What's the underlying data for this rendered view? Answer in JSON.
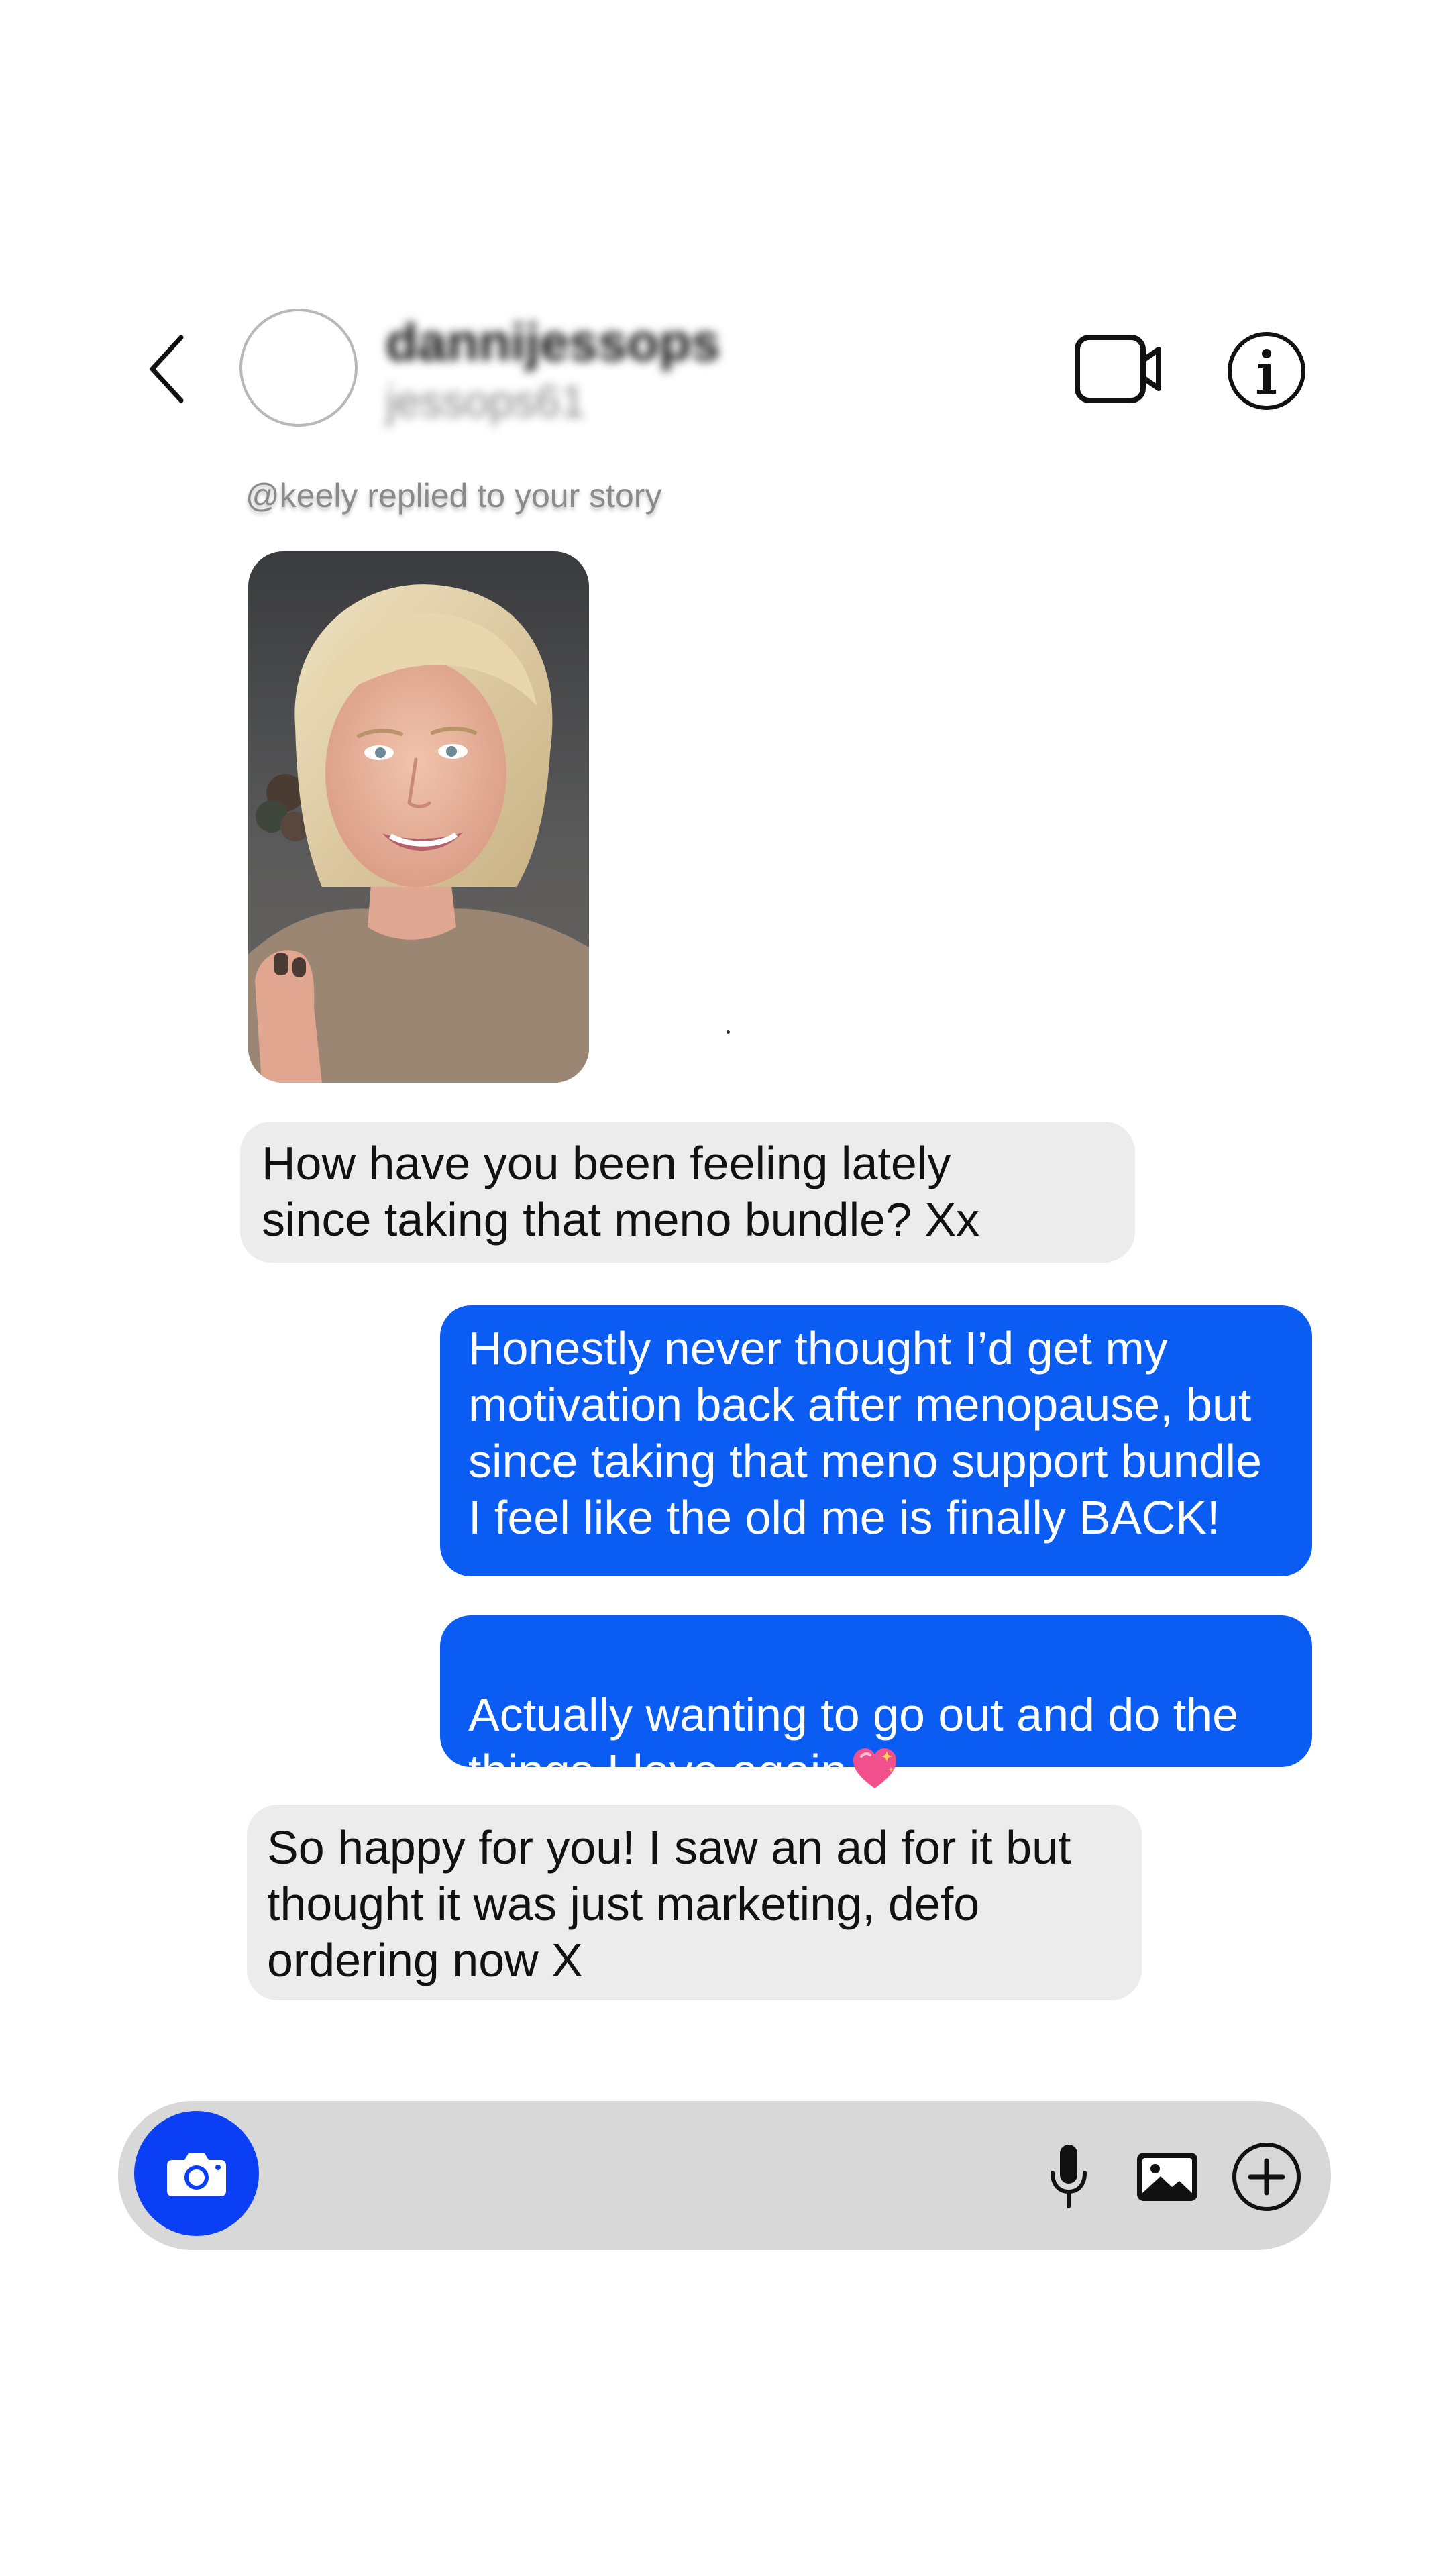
{
  "header": {
    "back_icon": "chevron-left-icon",
    "profile_name": "dannijessops",
    "profile_handle": "jessops61",
    "video_icon": "video-camera-icon",
    "info_icon": "info-icon"
  },
  "story": {
    "reply_note": "@keely replied to your story"
  },
  "messages": [
    {
      "direction": "incoming",
      "text": " How have you been feeling lately\nsince taking that meno bundle? Xx"
    },
    {
      "direction": "outgoing",
      "text": "Honestly never thought I’d get my\nmotivation back after menopause, but\nsince taking that meno support bundle\nI feel like the old me is finally BACK!"
    },
    {
      "direction": "outgoing",
      "text": "Actually wanting to go out and do the\nthings I love again",
      "emoji": "sparkling-heart-icon"
    },
    {
      "direction": "incoming",
      "text": "So happy for you! I saw an ad for it but\nthought it was just marketing, defo\nordering now X"
    }
  ],
  "composer": {
    "placeholder": "",
    "icons": [
      "camera-icon",
      "microphone-icon",
      "image-icon",
      "plus-circle-icon"
    ]
  },
  "colors": {
    "outgoing_bubble": "#0b5cf2",
    "incoming_bubble": "#ececec",
    "camera_button": "#0b3ff5",
    "composer_bar": "#d8d8d8"
  }
}
